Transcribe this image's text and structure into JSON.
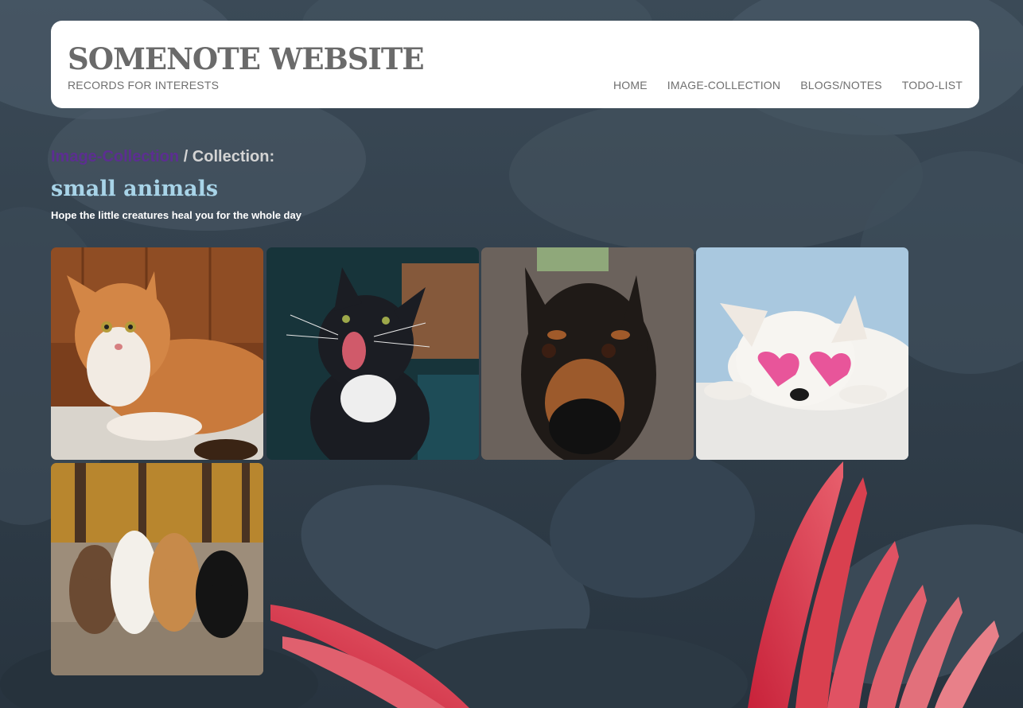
{
  "header": {
    "site_title": "SOMENOTE WEBSITE",
    "site_subtitle": "RECORDS FOR INTERESTS",
    "nav": [
      {
        "label": "HOME"
      },
      {
        "label": "IMAGE-COLLECTION"
      },
      {
        "label": "BLOGS/NOTES"
      },
      {
        "label": "TODO-LIST"
      }
    ]
  },
  "breadcrumb": {
    "link_label": "Image-Collection",
    "separator_text": " / Collection:"
  },
  "collection": {
    "title": "small animals",
    "description": "Hope the little creatures heal you for the whole day"
  },
  "gallery": {
    "images": [
      {
        "subject": "orange-and-white cat lying on a blanket"
      },
      {
        "subject": "black-and-white kitten meowing"
      },
      {
        "subject": "doberman puppy close-up"
      },
      {
        "subject": "white dog wearing pink heart sunglasses"
      },
      {
        "subject": "four pomeranian dogs in an autumn park"
      }
    ]
  },
  "colors": {
    "header_bg": "#ffffff",
    "title_gray": "#6a6a6a",
    "breadcrumb_link": "#5c2e91",
    "collection_title": "#a8d4e8",
    "page_bg": "#2f3d49"
  }
}
